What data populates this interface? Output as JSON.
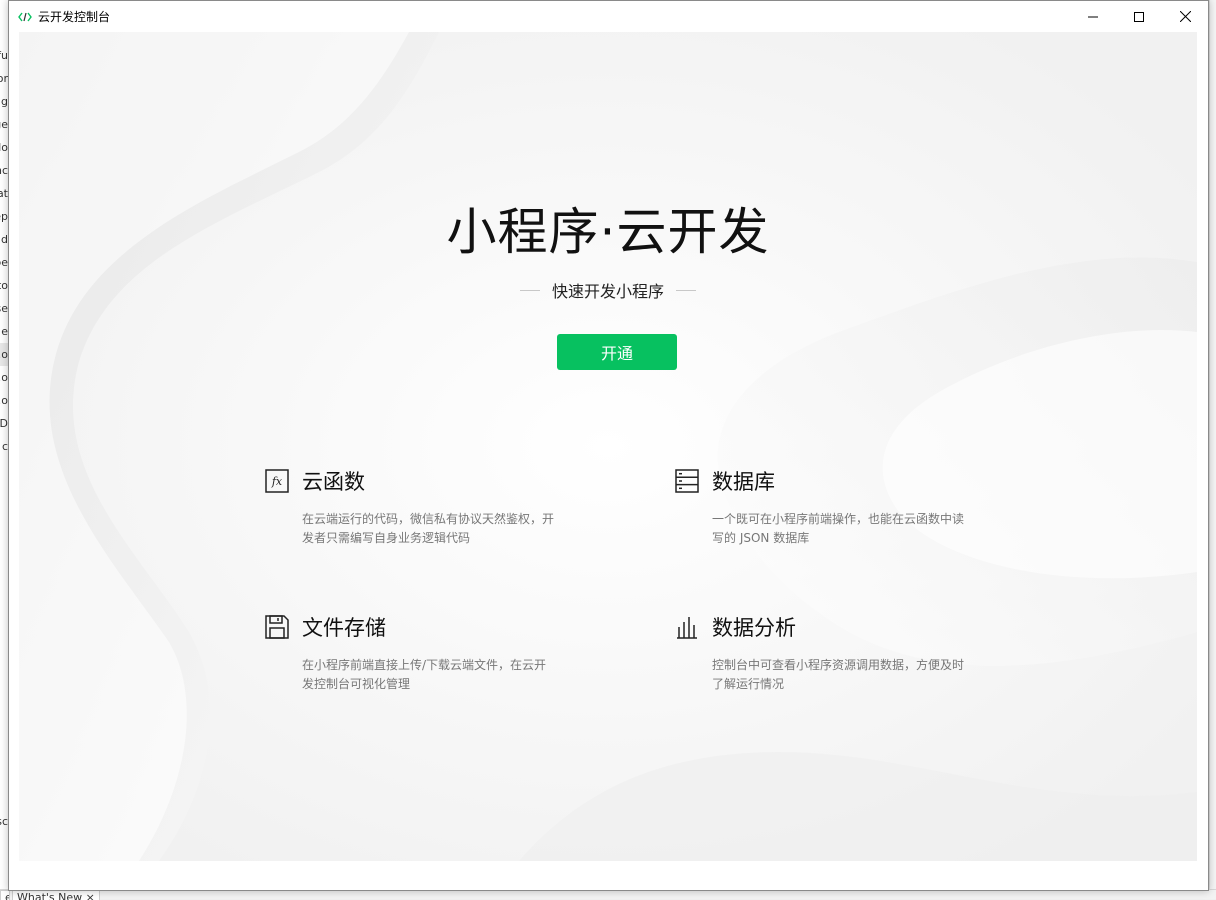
{
  "window": {
    "title": "云开发控制台",
    "minimize_icon": "minimize-icon",
    "maximize_icon": "maximize-icon",
    "close_icon": "close-icon"
  },
  "background_app": {
    "left_list": [
      "fu",
      "or",
      "g",
      "ge",
      "do",
      "nc",
      "at",
      "ep",
      "ad",
      "pe",
      "to",
      "se",
      "e",
      "o.",
      "o.",
      "o.",
      "D",
      "c"
    ],
    "left_lower": "sc",
    "tabs": [
      "e",
      "What's New ×"
    ]
  },
  "hero": {
    "title": "小程序·云开发",
    "subtitle": "快速开发小程序",
    "open_button": "开通"
  },
  "features": [
    {
      "icon": "function-fx-icon",
      "title": "云函数",
      "desc": "在云端运行的代码，微信私有协议天然鉴权，开发者只需编写自身业务逻辑代码"
    },
    {
      "icon": "database-icon",
      "title": "数据库",
      "desc": "一个既可在小程序前端操作，也能在云函数中读写的 JSON 数据库"
    },
    {
      "icon": "floppy-disk-icon",
      "title": "文件存储",
      "desc": "在小程序前端直接上传/下载云端文件，在云开发控制台可视化管理"
    },
    {
      "icon": "bar-chart-icon",
      "title": "数据分析",
      "desc": "控制台中可查看小程序资源调用数据，方便及时了解运行情况"
    }
  ],
  "colors": {
    "accent": "#07c160",
    "title_text": "#111111",
    "desc_text": "#777777"
  }
}
